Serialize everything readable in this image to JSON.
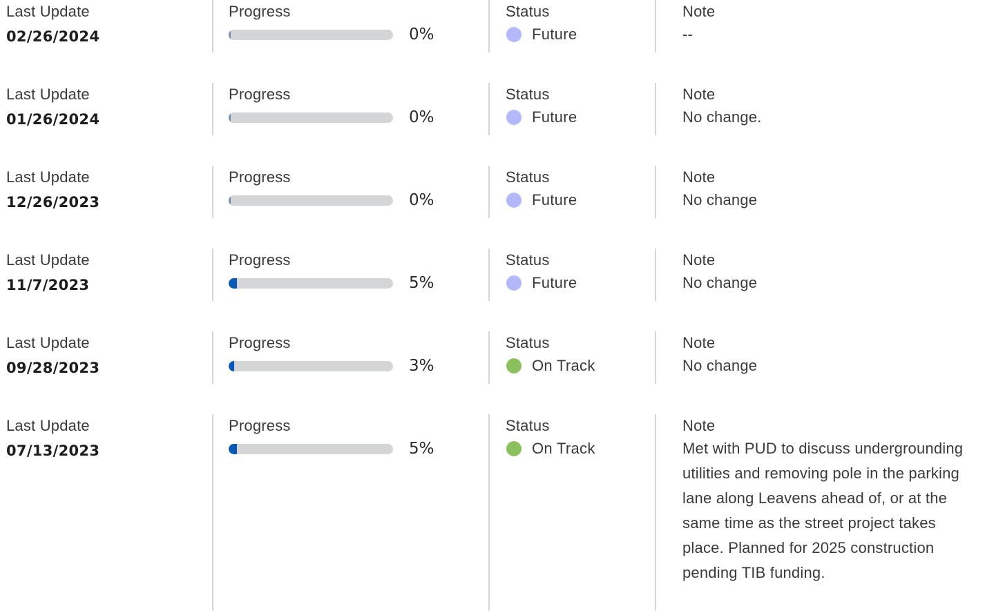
{
  "labels": {
    "last_update": "Last Update",
    "progress": "Progress",
    "status": "Status",
    "note": "Note"
  },
  "colors": {
    "progress_fill": "#0a58b6",
    "progress_track": "#d3d5d6",
    "status_future": "#b3b8fb",
    "status_on_track": "#8cc05e"
  },
  "updates": [
    {
      "date": "02/26/2024",
      "progress": 0,
      "progress_label": "0%",
      "status": "Future",
      "status_color": "#b3b8fb",
      "note": "--"
    },
    {
      "date": "01/26/2024",
      "progress": 0,
      "progress_label": "0%",
      "status": "Future",
      "status_color": "#b3b8fb",
      "note": "No change."
    },
    {
      "date": "12/26/2023",
      "progress": 0,
      "progress_label": "0%",
      "status": "Future",
      "status_color": "#b3b8fb",
      "note": "No change"
    },
    {
      "date": "11/7/2023",
      "progress": 5,
      "progress_label": "5%",
      "status": "Future",
      "status_color": "#b3b8fb",
      "note": "No change"
    },
    {
      "date": "09/28/2023",
      "progress": 3,
      "progress_label": "3%",
      "status": "On Track",
      "status_color": "#8cc05e",
      "note": "No change"
    },
    {
      "date": "07/13/2023",
      "progress": 5,
      "progress_label": "5%",
      "status": "On Track",
      "status_color": "#8cc05e",
      "note": "Met with PUD to discuss undergrounding utilities and removing pole in the parking lane along Leavens ahead of, or at the same time as the street project takes place. Planned for 2025 construction pending TIB funding."
    }
  ]
}
